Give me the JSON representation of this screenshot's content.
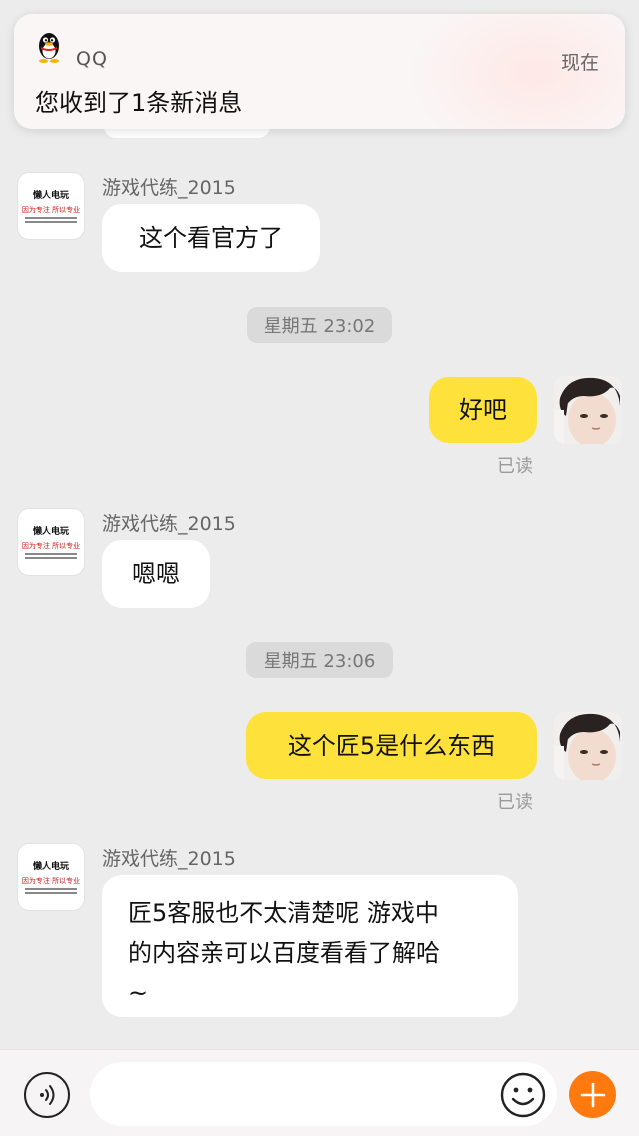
{
  "notification": {
    "app_name": "QQ",
    "time": "现在",
    "message": "您收到了1条新消息"
  },
  "contact": {
    "name": "游戏代练_2015",
    "avatar_text": "懒人电玩",
    "avatar_slogan": "因为专注 所以专业"
  },
  "messages": [
    {
      "type": "incoming",
      "sender": "游戏代练_2015",
      "text": "这个看官方了"
    },
    {
      "type": "timestamp",
      "text": "星期五 23:02"
    },
    {
      "type": "outgoing",
      "text": "好吧",
      "status": "已读"
    },
    {
      "type": "incoming",
      "sender": "游戏代练_2015",
      "text": "嗯嗯"
    },
    {
      "type": "timestamp",
      "text": "星期五 23:06"
    },
    {
      "type": "outgoing",
      "text": "这个匠5是什么东西",
      "status": "已读"
    },
    {
      "type": "incoming",
      "sender": "游戏代练_2015",
      "lines": [
        "匠5客服也不太清楚呢 游戏中",
        "的内容亲可以百度看看了解哈",
        "~"
      ]
    }
  ],
  "input": {
    "value": "",
    "placeholder": ""
  },
  "icons": {
    "notification_app": "qq-penguin-icon",
    "voice": "voice-icon",
    "emoji": "emoji-icon",
    "plus": "plus-icon"
  },
  "colors": {
    "outgoing_bubble": "#ffe13b",
    "incoming_bubble": "#ffffff",
    "background": "#ececec",
    "plus_button": "#ff7a0e"
  }
}
